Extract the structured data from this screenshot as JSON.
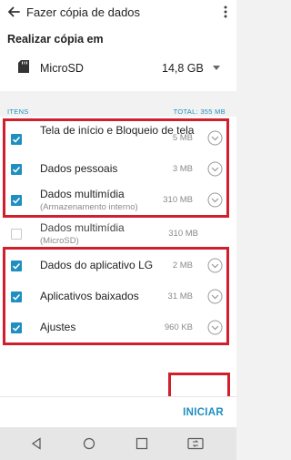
{
  "header": {
    "title": "Fazer cópia de dados",
    "back_icon": "back-arrow-icon",
    "more_icon": "more-vert-icon"
  },
  "backup": {
    "label": "Realizar cópia em",
    "destination": "MicroSD",
    "size": "14,8 GB",
    "icon": "sd-card-icon"
  },
  "items_header": {
    "left": "ITENS",
    "right": "TOTAL: 355 MB"
  },
  "items": [
    {
      "name": "Tela de início e Bloqueio de tela",
      "size": "5 MB",
      "checked": true
    },
    {
      "name": "Dados pessoais",
      "size": "3 MB",
      "checked": true
    },
    {
      "name": "Dados multimídia",
      "sub": "(Armazenamento interno)",
      "size": "310 MB",
      "checked": true
    },
    {
      "name": "Dados multimídia",
      "sub": "(MicroSD)",
      "size": "310 MB",
      "checked": false
    },
    {
      "name": "Dados do aplicativo LG",
      "size": "2 MB",
      "checked": true
    },
    {
      "name": "Aplicativos baixados",
      "size": "31 MB",
      "checked": true
    },
    {
      "name": "Ajustes",
      "size": "960 KB",
      "checked": true
    }
  ],
  "footer": {
    "start_label": "INICIAR"
  },
  "colors": {
    "accent": "#1f8fbf",
    "highlight": "#d0202e"
  }
}
